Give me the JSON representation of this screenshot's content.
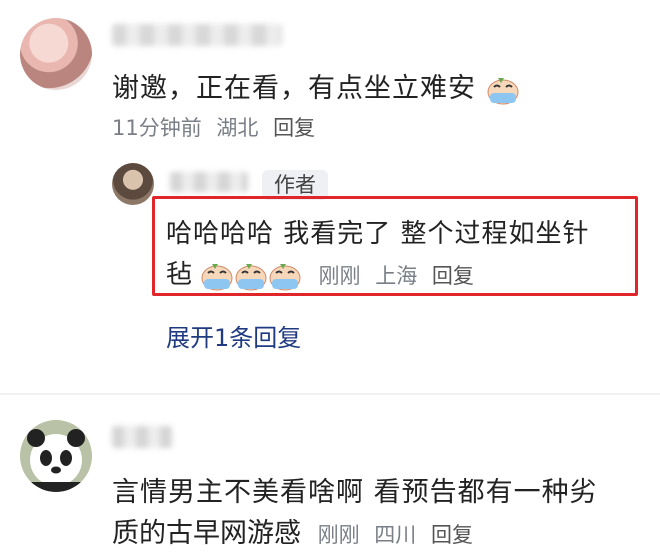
{
  "comment1": {
    "text": "谢邀，正在看，有点坐立难安",
    "time": "11分钟前",
    "location": "湖北",
    "reply_label": "回复"
  },
  "reply1": {
    "badge": "作者",
    "text_line1": "哈哈哈哈 我看完了 整个过程如坐针",
    "text_line2": "毡",
    "time": "刚刚",
    "location": "上海",
    "reply_label": "回复"
  },
  "expand_label": "展开1条回复",
  "comment2": {
    "text_line1": "言情男主不美看啥啊 看预告都有一种劣",
    "text_line2": "质的古早网游感",
    "time": "刚刚",
    "location": "四川",
    "reply_label": "回复"
  },
  "colors": {
    "highlight": "#e0262a",
    "link": "#1f3a80",
    "meta": "#7a7f87"
  },
  "icons": [
    "crying-face-icon"
  ]
}
